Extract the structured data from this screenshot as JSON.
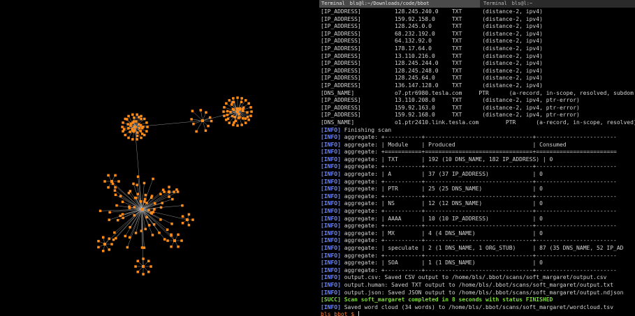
{
  "terminal": {
    "tabs": [
      {
        "name": "Terminal",
        "title": "bls@l:~/Downloads/code/bbot",
        "active": true
      },
      {
        "name": "Terminal",
        "title": "bls@l:~",
        "active": false
      }
    ],
    "lines": [
      {
        "kind": "plain",
        "text": "[IP_ADDRESS]          128.245.240.0    TXT      (distance-2, ipv4)"
      },
      {
        "kind": "plain",
        "text": "[IP_ADDRESS]          159.92.158.0     TXT      (distance-2, ipv4)"
      },
      {
        "kind": "plain",
        "text": "[IP_ADDRESS]          128.245.0.0      TXT      (distance-2, ipv4)"
      },
      {
        "kind": "plain",
        "text": "[IP_ADDRESS]          68.232.192.0     TXT      (distance-2, ipv4)"
      },
      {
        "kind": "plain",
        "text": "[IP_ADDRESS]          64.132.92.0      TXT      (distance-2, ipv4)"
      },
      {
        "kind": "plain",
        "text": "[IP_ADDRESS]          178.17.64.0      TXT      (distance-2, ipv4)"
      },
      {
        "kind": "plain",
        "text": "[IP_ADDRESS]          13.110.216.0     TXT      (distance-2, ipv4)"
      },
      {
        "kind": "plain",
        "text": "[IP_ADDRESS]          128.245.244.0    TXT      (distance-2, ipv4)"
      },
      {
        "kind": "plain",
        "text": "[IP_ADDRESS]          128.245.248.0    TXT      (distance-2, ipv4)"
      },
      {
        "kind": "plain",
        "text": "[IP_ADDRESS]          128.245.64.0     TXT      (distance-2, ipv4)"
      },
      {
        "kind": "plain",
        "text": "[IP_ADDRESS]          136.147.128.0    TXT      (distance-2, ipv4)"
      },
      {
        "kind": "plain",
        "text": "[DNS_NAME]            o7.ptr6980.tesla.com     PTR      (a-record, in-scope, resolved, subdom"
      },
      {
        "kind": "plain",
        "text": "[IP_ADDRESS]          13.110.208.0     TXT      (distance-2, ipv4, ptr-error)"
      },
      {
        "kind": "plain",
        "text": "[IP_ADDRESS]          159.92.163.0     TXT      (distance-2, ipv4, ptr-error)"
      },
      {
        "kind": "plain",
        "text": "[IP_ADDRESS]          159.92.168.0     TXT      (distance-2, ipv4, ptr-error)"
      },
      {
        "kind": "plain",
        "text": "[DNS_NAME]            o1.ptr2410.link.tesla.com        PTR      (a-record, in-scope, resolved)"
      },
      {
        "kind": "info",
        "tag": "[INFO]",
        "text": " Finishing scan"
      },
      {
        "kind": "info",
        "tag": "[INFO]",
        "text": " aggregate: +-----------+--------------------------------+------------------------"
      },
      {
        "kind": "info",
        "tag": "[INFO]",
        "text": " aggregate: | Module    | Produced                       | Consumed"
      },
      {
        "kind": "info",
        "tag": "[INFO]",
        "text": " aggregate: +===========+================================+========================"
      },
      {
        "kind": "info",
        "tag": "[INFO]",
        "text": " aggregate: | TXT       | 192 (10 DNS_NAME, 182 IP_ADDRESS) | 0"
      },
      {
        "kind": "info",
        "tag": "[INFO]",
        "text": " aggregate: +-----------+--------------------------------+------------------------"
      },
      {
        "kind": "info",
        "tag": "[INFO]",
        "text": " aggregate: | A         | 37 (37 IP_ADDRESS)             | 0"
      },
      {
        "kind": "info",
        "tag": "[INFO]",
        "text": " aggregate: +-----------+--------------------------------+------------------------"
      },
      {
        "kind": "info",
        "tag": "[INFO]",
        "text": " aggregate: | PTR       | 25 (25 DNS_NAME)               | 0"
      },
      {
        "kind": "info",
        "tag": "[INFO]",
        "text": " aggregate: +-----------+--------------------------------+------------------------"
      },
      {
        "kind": "info",
        "tag": "[INFO]",
        "text": " aggregate: | NS        | 12 (12 DNS_NAME)               | 0"
      },
      {
        "kind": "info",
        "tag": "[INFO]",
        "text": " aggregate: +-----------+--------------------------------+------------------------"
      },
      {
        "kind": "info",
        "tag": "[INFO]",
        "text": " aggregate: | AAAA      | 10 (10 IP_ADDRESS)             | 0"
      },
      {
        "kind": "info",
        "tag": "[INFO]",
        "text": " aggregate: +-----------+--------------------------------+------------------------"
      },
      {
        "kind": "info",
        "tag": "[INFO]",
        "text": " aggregate: | MX        | 4 (4 DNS_NAME)                 | 0"
      },
      {
        "kind": "info",
        "tag": "[INFO]",
        "text": " aggregate: +-----------+--------------------------------+------------------------"
      },
      {
        "kind": "info",
        "tag": "[INFO]",
        "text": " aggregate: | speculate | 2 (1 DNS_NAME, 1 ORG_STUB)     | 87 (35 DNS_NAME, 52 IP_AD"
      },
      {
        "kind": "info",
        "tag": "[INFO]",
        "text": " aggregate: +-----------+--------------------------------+------------------------"
      },
      {
        "kind": "info",
        "tag": "[INFO]",
        "text": " aggregate: | SOA       | 1 (1 DNS_NAME)                 | 0"
      },
      {
        "kind": "info",
        "tag": "[INFO]",
        "text": " aggregate: +-----------+--------------------------------+------------------------"
      },
      {
        "kind": "info",
        "tag": "[INFO]",
        "text": " output.csv: Saved CSV output to /home/bls/.bbot/scans/soft_margaret/output.csv"
      },
      {
        "kind": "info",
        "tag": "[INFO]",
        "text": " output.human: Saved TXT output to /home/bls/.bbot/scans/soft_margaret/output.txt"
      },
      {
        "kind": "info",
        "tag": "[INFO]",
        "text": " output.json: Saved JSON output to /home/bls/.bbot/scans/soft_margaret/output.ndjson"
      },
      {
        "kind": "succ",
        "tag": "[SUCC]",
        "text": " Scan soft_margaret completed in 8 seconds with status FINISHED"
      },
      {
        "kind": "info",
        "tag": "[INFO]",
        "text": " Saved word cloud (34 words) to /home/bls/.bbot/scans/soft_margaret/wordcloud.tsv"
      },
      {
        "kind": "prompt",
        "text": "bls bbot $ "
      }
    ]
  },
  "graph": {
    "node_color": "#ff8c1a",
    "edge_color": "#bdbdbd",
    "background": "#000000"
  }
}
